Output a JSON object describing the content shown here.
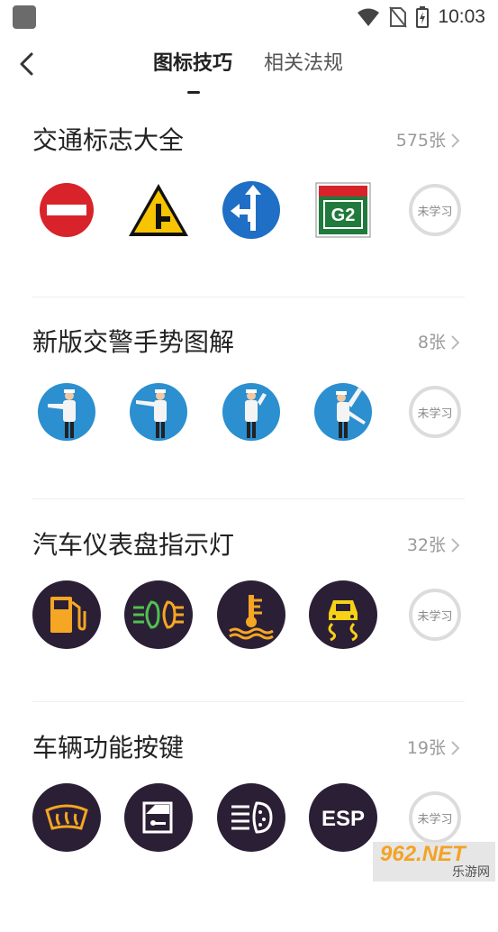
{
  "status_bar": {
    "time": "10:03"
  },
  "nav": {
    "tabs": [
      {
        "label": "图标技巧",
        "active": true
      },
      {
        "label": "相关法规",
        "active": false
      }
    ]
  },
  "sections": [
    {
      "title": "交通标志大全",
      "count": "575张",
      "icons": [
        "no-entry-sign-icon",
        "t-junction-warning-sign-icon",
        "straight-or-left-sign-icon",
        "expressway-g2-sign-icon"
      ],
      "status_label": "未学习"
    },
    {
      "title": "新版交警手势图解",
      "count": "8张",
      "icons": [
        "police-gesture-stop-icon",
        "police-gesture-straight-icon",
        "police-gesture-left-turn-icon",
        "police-gesture-right-turn-icon"
      ],
      "status_label": "未学习"
    },
    {
      "title": "汽车仪表盘指示灯",
      "count": "32张",
      "icons": [
        "fuel-warning-icon",
        "fog-light-icon",
        "coolant-temperature-icon",
        "skid-control-icon"
      ],
      "status_label": "未学习"
    },
    {
      "title": "车辆功能按键",
      "count": "19张",
      "icons": [
        "windshield-defrost-icon",
        "door-key-icon",
        "headlight-washer-icon",
        "esp-icon"
      ],
      "status_label": "未学习"
    }
  ],
  "sign_text": {
    "g2": "G2",
    "esp": "ESP"
  },
  "watermark": {
    "main": "962.NET",
    "sub": "乐游网"
  },
  "colors": {
    "sign_red": "#d8232a",
    "sign_blue": "#1e6fc5",
    "sign_yellow": "#f6c400",
    "sign_green": "#1f7a3c",
    "gesture_bg": "#2b8fd0",
    "dashboard_bg": "#2b1f35",
    "dashboard_orange": "#f5a623",
    "dashboard_yellow": "#f7d116",
    "dashboard_green": "#4fc24f"
  }
}
